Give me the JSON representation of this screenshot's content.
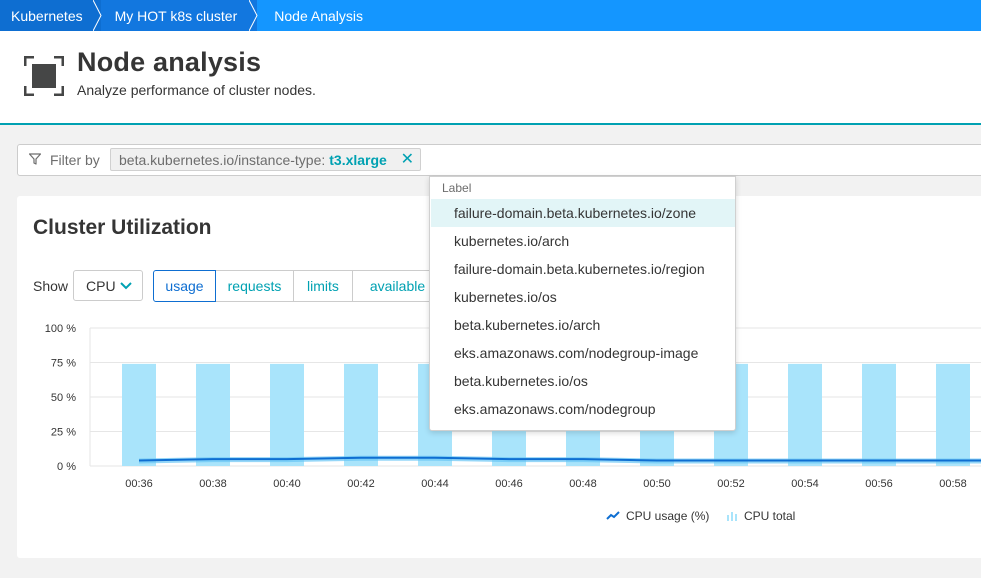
{
  "breadcrumb": {
    "items": [
      "Kubernetes",
      "My HOT k8s cluster",
      "Node Analysis"
    ]
  },
  "header": {
    "title": "Node analysis",
    "subtitle": "Analyze performance of cluster nodes.",
    "icon": "node-analysis-icon"
  },
  "filter": {
    "label": "Filter by",
    "chip_key": "beta.kubernetes.io/instance-type:",
    "chip_value": "t3.xlarge",
    "chip_close": "✕"
  },
  "card": {
    "title": "Cluster Utilization",
    "show_label": "Show",
    "metric_select": "CPU",
    "tabs": [
      "usage",
      "requests",
      "limits",
      "available"
    ],
    "active_tab": "usage"
  },
  "dropdown": {
    "header": "Label",
    "items": [
      "failure-domain.beta.kubernetes.io/zone",
      "kubernetes.io/arch",
      "failure-domain.beta.kubernetes.io/region",
      "kubernetes.io/os",
      "beta.kubernetes.io/arch",
      "eks.amazonaws.com/nodegroup-image",
      "beta.kubernetes.io/os",
      "eks.amazonaws.com/nodegroup"
    ],
    "highlighted_index": 0
  },
  "colors": {
    "accent": "#00a1b2",
    "breadcrumb": "#1496ff",
    "bar": "#a9e4fb",
    "usage_line": "#0e6ed1",
    "usage_band": "#6ac6f5"
  },
  "chart_data": {
    "type": "bar",
    "x": [
      "00:36",
      "00:38",
      "00:40",
      "00:42",
      "00:44",
      "00:46",
      "00:48",
      "00:50",
      "00:52",
      "00:54",
      "00:56",
      "00:58"
    ],
    "ylim": [
      0,
      100
    ],
    "yticks": [
      "100 %",
      "75 %",
      "50 %",
      "25 %",
      "0 %"
    ],
    "ytick_values": [
      100,
      75,
      50,
      25,
      0
    ],
    "grid": true,
    "series": [
      {
        "name": "CPU usage (%)",
        "kind": "line",
        "values": [
          4,
          5,
          5,
          6,
          6,
          5,
          5,
          4,
          4,
          4,
          4,
          4
        ]
      },
      {
        "name": "CPU total",
        "kind": "bar",
        "values": [
          74,
          74,
          74,
          74,
          74,
          74,
          74,
          74,
          74,
          74,
          74,
          74
        ]
      }
    ],
    "legend": [
      "CPU usage (%)",
      "CPU total"
    ]
  }
}
